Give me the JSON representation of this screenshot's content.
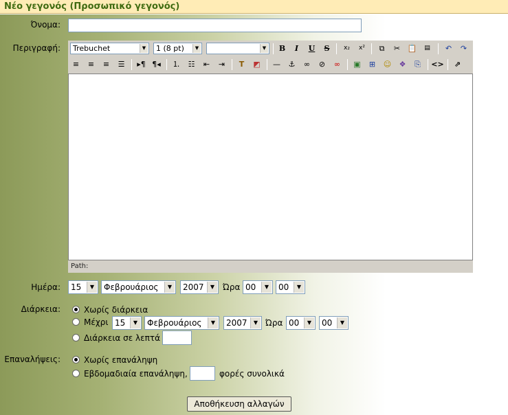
{
  "title": "Νέο γεγονός (Προσωπικό γεγονός)",
  "name_label": "Όνομα:",
  "description_label": "Περιγραφή:",
  "editor": {
    "font": "Trebuchet",
    "size": "1 (8 pt)",
    "style": "",
    "buttons": [
      "B",
      "I",
      "U",
      "S",
      "x₂",
      "x²",
      "copy",
      "cut",
      "paste",
      "clean",
      "undo",
      "redo",
      "align-left",
      "align-center",
      "align-right",
      "justify",
      "ltr",
      "rtl",
      "ordered-list",
      "unordered-list",
      "outdent",
      "indent",
      "text-color",
      "bg-color",
      "hr",
      "anchor",
      "link",
      "unlink",
      "nolink",
      "image",
      "table",
      "smiley",
      "insert-char",
      "search-replace",
      "html-source",
      "fullscreen"
    ],
    "path_label": "Path:"
  },
  "day_label": "Ημέρα:",
  "date": {
    "day": "15",
    "month": "Φεβρουάριος",
    "year": "2007",
    "hour_label": "Ώρα",
    "hour": "00",
    "minute": "00"
  },
  "duration_label": "Διάρκεια:",
  "duration": {
    "none": "Χωρίς διάρκεια",
    "until": "Μέχρι",
    "until_date": {
      "day": "15",
      "month": "Φεβρουάριος",
      "year": "2007",
      "hour_label": "Ώρα",
      "hour": "00",
      "minute": "00"
    },
    "minutes": "Διάρκεια σε λεπτά"
  },
  "repeat_label": "Επαναλήψεις:",
  "repeat": {
    "none": "Χωρίς επανάληψη",
    "weekly": "Εβδομαδιαία επανάληψη,",
    "times": "φορές συνολικά"
  },
  "save_button": "Αποθήκευση αλλαγών"
}
